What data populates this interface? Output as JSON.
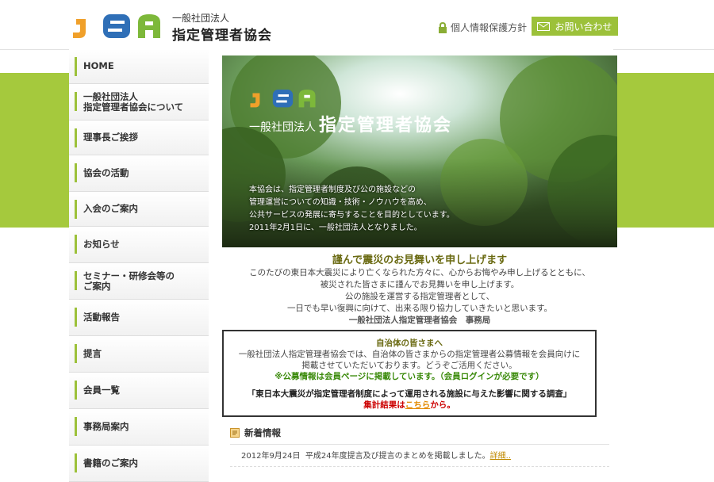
{
  "header": {
    "org_small": "一般社団法人",
    "org_big": "指定管理者協会",
    "privacy_label": "個人情報保護方針",
    "contact_label": "お問い合わせ",
    "logo_text": "JSA"
  },
  "sidebar": {
    "items": [
      {
        "label": "HOME"
      },
      {
        "label": "一般社団法人\n指定管理者協会について"
      },
      {
        "label": "理事長ご挨拶"
      },
      {
        "label": "協会の活動"
      },
      {
        "label": "入会のご案内"
      },
      {
        "label": "お知らせ"
      },
      {
        "label": "セミナー・研修会等の\nご案内"
      },
      {
        "label": "活動報告"
      },
      {
        "label": "提言"
      },
      {
        "label": "会員一覧"
      },
      {
        "label": "事務局案内"
      },
      {
        "label": "書籍のご案内"
      }
    ]
  },
  "hero": {
    "logo_text": "JSA",
    "org_small": "一般社団法人",
    "org_big": "指定管理者協会",
    "lines": [
      "本協会は、指定管理者制度及び公の施設などの",
      "管理運営についての知識・技術・ノウハウを高め、",
      "公共サービスの発展に寄与することを目的としています。",
      "2011年2月1日に、一般社団法人となりました。"
    ]
  },
  "message": {
    "title": "謹んで震災のお見舞いを申し上げます",
    "lines": [
      "このたびの東日本大震災により亡くなられた方々に、心からお悔やみ申し上げるとともに、",
      "被災された皆さまに謹んでお見舞いを申し上げます。",
      "公の施設を運営する指定管理者として、",
      "一日でも早い復興に向けて、出来る限り協力していきたいと思います。"
    ],
    "signature": "一般社団法人指定管理者協会　事務局"
  },
  "notice": {
    "title": "自治体の皆さまへ",
    "line1": "一般社団法人指定管理者協会では、自治体の皆さまからの指定管理者公募情報を会員向けに",
    "line2": "掲載させていただいております。どうぞご活用ください。",
    "green": "※公募情報は会員ページに掲載しています。（会員ログインが必要です）",
    "survey": "「東日本大震災が指定管理者制度によって運用される施設に与えた影響に関する調査」",
    "result_prefix": "集計結果は",
    "result_link": "こちら",
    "result_suffix": "から。"
  },
  "news": {
    "heading": "新着情報",
    "items": [
      {
        "date": "2012年9月24日",
        "text": "平成24年度提言及び提言のまとめを掲載しました。",
        "link": "詳細.."
      }
    ]
  },
  "colors": {
    "accent": "#9cc13a",
    "band": "#a5c93d"
  }
}
